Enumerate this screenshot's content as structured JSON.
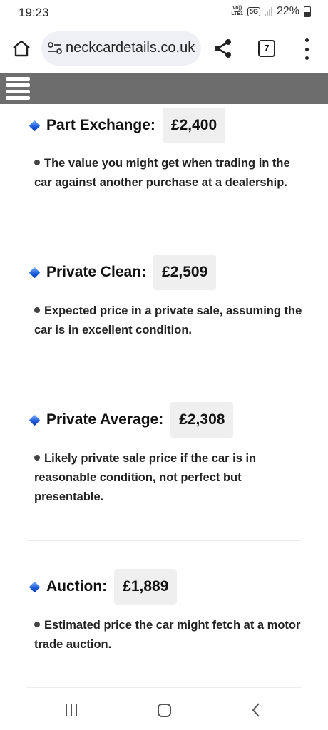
{
  "status_bar": {
    "time": "19:23",
    "volte_line1": "Vo))",
    "volte_line2": "LTE1",
    "network": "5G",
    "battery": "22%"
  },
  "browser": {
    "url": " eckcardetails.co.uk",
    "url_display": "neckcardetails.co.uk",
    "tab_count": "7"
  },
  "sections": [
    {
      "label": "Part Exchange:",
      "price": "£2,400",
      "description": "The value you might get when trading in the car against another purchase at a dealership."
    },
    {
      "label": "Private Clean:",
      "price": "£2,509",
      "description": "Expected price in a private sale, assuming the car is in excellent condition."
    },
    {
      "label": "Private Average:",
      "price": "£2,308",
      "description": "Likely private sale price if the car is in reasonable condition, not perfect but presentable."
    },
    {
      "label": "Auction:",
      "price": "£1,889",
      "description": "Estimated price the car might fetch at a motor trade auction."
    }
  ],
  "colors": {
    "header": "#6d6d6d",
    "url_pill": "#eef0f6",
    "price_box": "#efefef",
    "diamond": "#1a5ad8"
  },
  "icons": {
    "home": "home-icon",
    "site_settings": "site-settings-icon",
    "share": "share-icon",
    "menu": "more-vert-icon",
    "hamburger": "hamburger-menu-icon",
    "bullet": "diamond-icon"
  }
}
